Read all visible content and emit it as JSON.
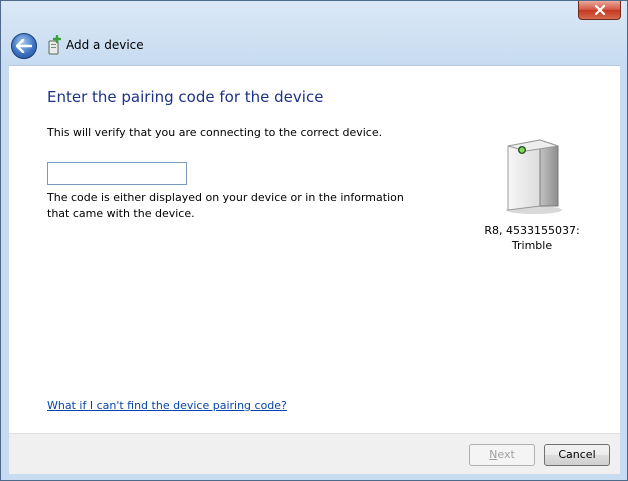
{
  "window": {
    "close_label": "Close"
  },
  "header": {
    "title": "Add a device",
    "back_icon": "back-arrow-icon",
    "device_icon": "add-device-icon"
  },
  "main": {
    "heading": "Enter the pairing code for the device",
    "verify_text": "This will verify that you are connecting to the correct device.",
    "code_input": {
      "value": "",
      "placeholder": ""
    },
    "hint_text": "The code is either displayed on your device or in the information that came with the device.",
    "device": {
      "icon": "device-tower-icon",
      "name_line1": "R8, 4533155037:",
      "name_line2": "Trimble"
    },
    "help_link": "What if I can't find the device pairing code?"
  },
  "footer": {
    "next_label_first": "N",
    "next_label_rest": "ext",
    "cancel_label": "Cancel"
  },
  "colors": {
    "heading": "#1e3287",
    "link": "#0645ad",
    "close_button": "#c8442a"
  }
}
